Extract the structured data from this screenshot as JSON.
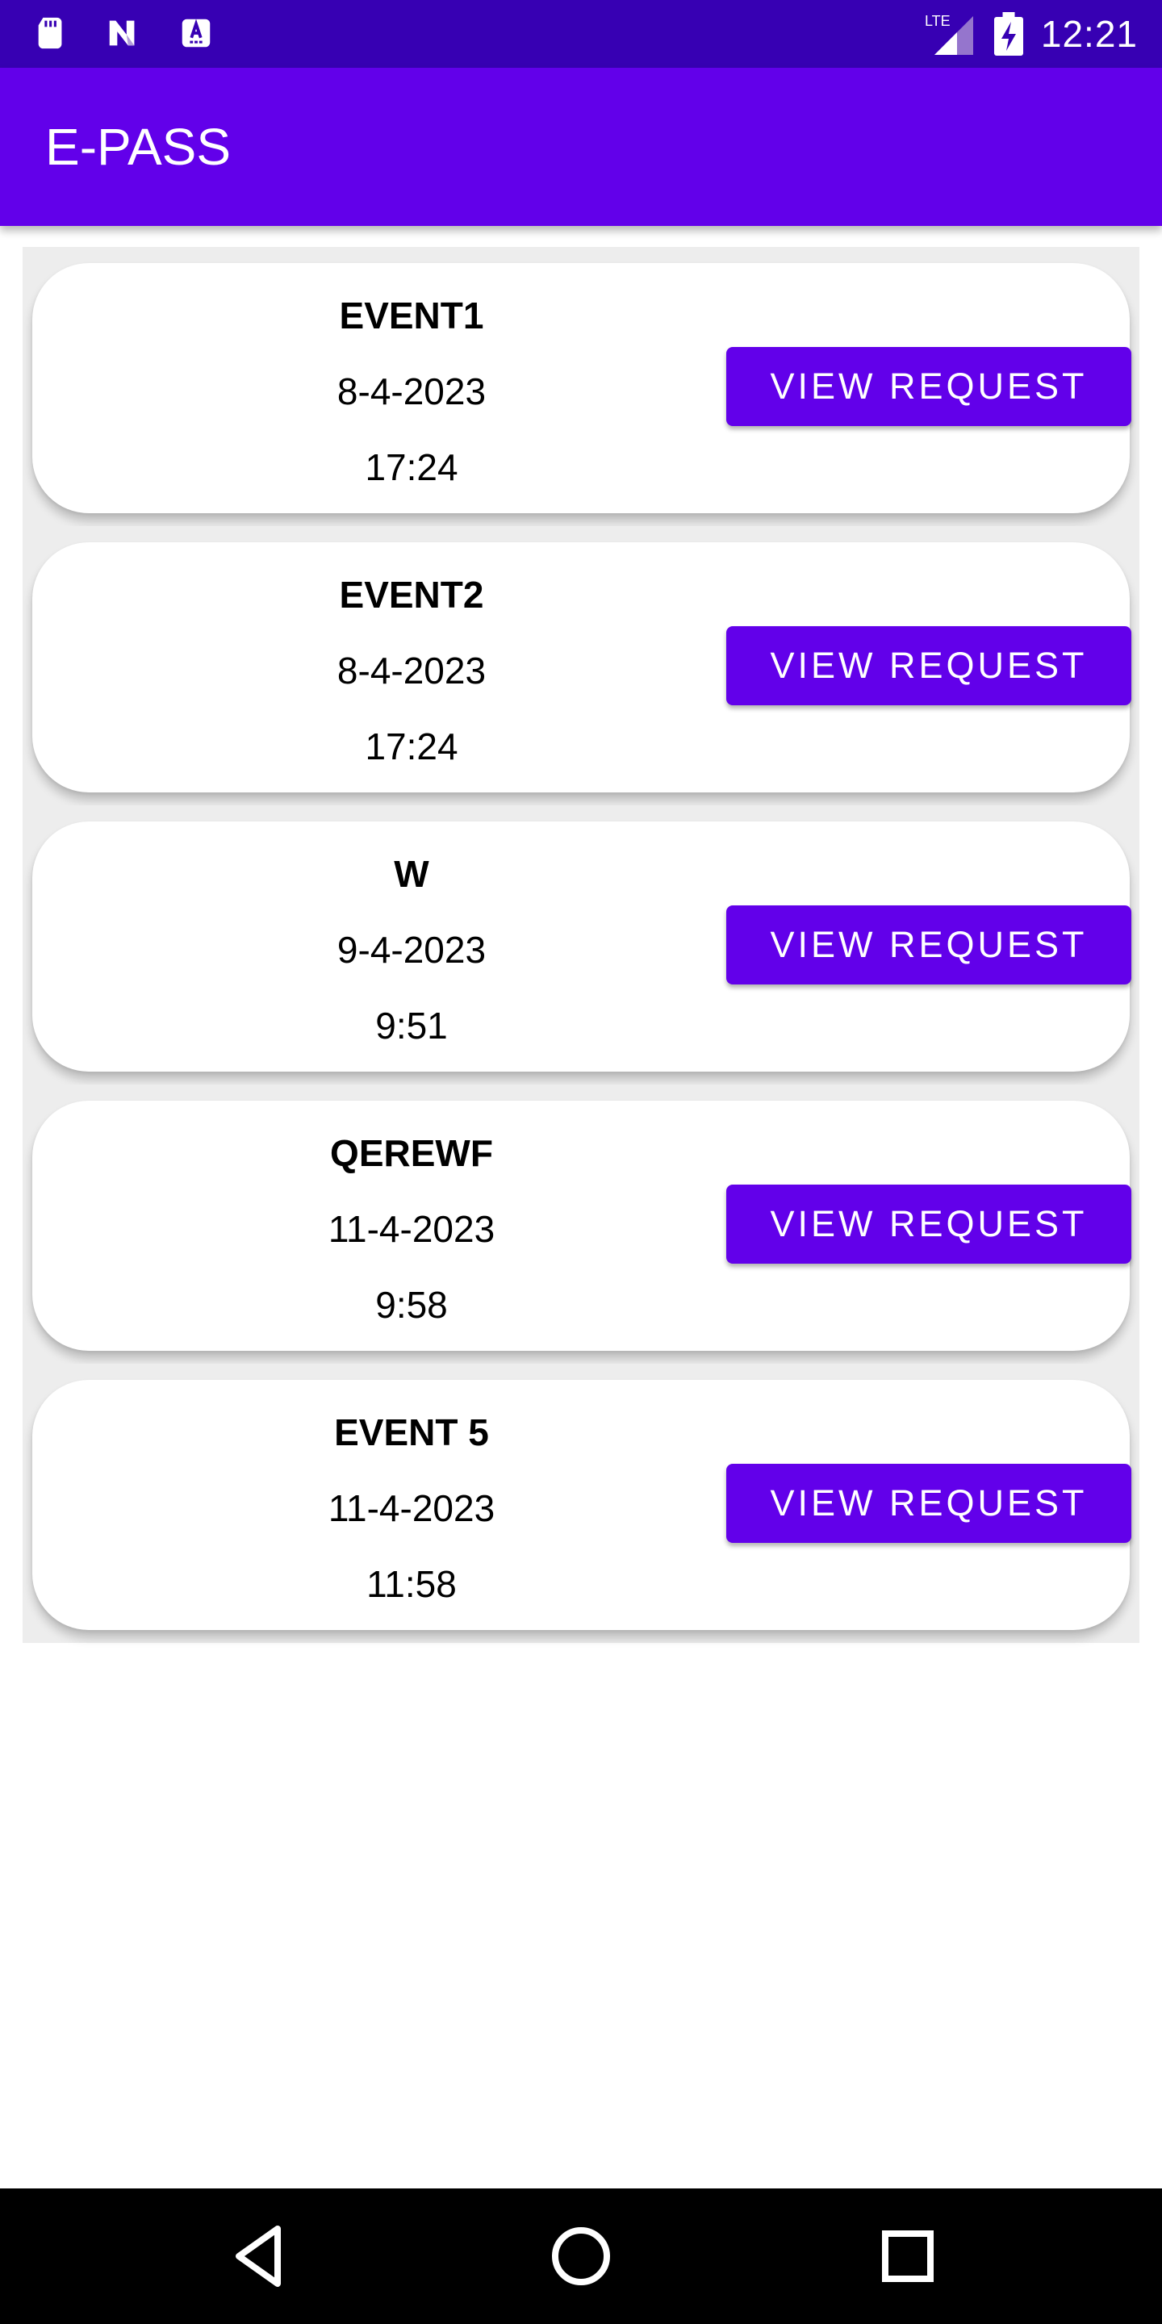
{
  "status_bar": {
    "time": "12:21",
    "left_icons": [
      "sd-card-icon",
      "n-logo-icon",
      "a-keyboard-icon"
    ],
    "right_icons": [
      "lte-signal-icon",
      "battery-charging-icon"
    ]
  },
  "app_bar": {
    "title": "E-PASS"
  },
  "events": [
    {
      "name": "EVENT1",
      "date": "8-4-2023",
      "time": "17:24",
      "button": "VIEW REQUEST"
    },
    {
      "name": "EVENT2",
      "date": "8-4-2023",
      "time": "17:24",
      "button": "VIEW REQUEST"
    },
    {
      "name": "W",
      "date": "9-4-2023",
      "time": "9:51",
      "button": "VIEW REQUEST"
    },
    {
      "name": "QEREWF",
      "date": "11-4-2023",
      "time": "9:58",
      "button": "VIEW REQUEST"
    },
    {
      "name": "EVENT 5",
      "date": "11-4-2023",
      "time": "11:58",
      "button": "VIEW REQUEST"
    }
  ],
  "nav_bar": {
    "icons": [
      "back-icon",
      "home-icon",
      "recents-icon"
    ]
  },
  "colors": {
    "status_bar": "#3700b3",
    "primary": "#6200ea",
    "row_background": "#ededed",
    "card": "#ffffff",
    "nav_bar": "#000000"
  }
}
